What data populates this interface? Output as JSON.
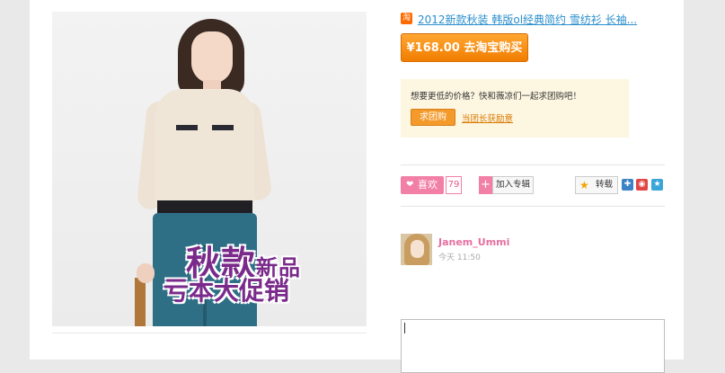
{
  "product": {
    "source_badge": "淘",
    "title": "2012新款秋装 韩版ol经典简约 雪纺衫 长袖...",
    "buy_label": "¥168.00 去淘宝购买",
    "image_promo_line1_big": "秋款",
    "image_promo_line1_small": "新品",
    "image_promo_line2": "亏本大促销"
  },
  "group_buy": {
    "prompt": "想要更低的价格？快和薇凉们一起求团购吧！",
    "button_label": "求团购",
    "link_label": "当团长获励意"
  },
  "actions": {
    "like_label": "喜欢",
    "like_count": "79",
    "album_plus": "+",
    "album_label": "加入专辑",
    "share_label": "转载"
  },
  "share_icons": [
    "qq-share-icon",
    "weibo-share-icon",
    "qzone-share-icon"
  ],
  "user": {
    "name": "Janem_Ummi",
    "time": "今天 11:50"
  },
  "colors": {
    "buy_orange": "#f39a2a",
    "like_pink": "#f27fa6",
    "link_blue": "#2a8fcc"
  }
}
